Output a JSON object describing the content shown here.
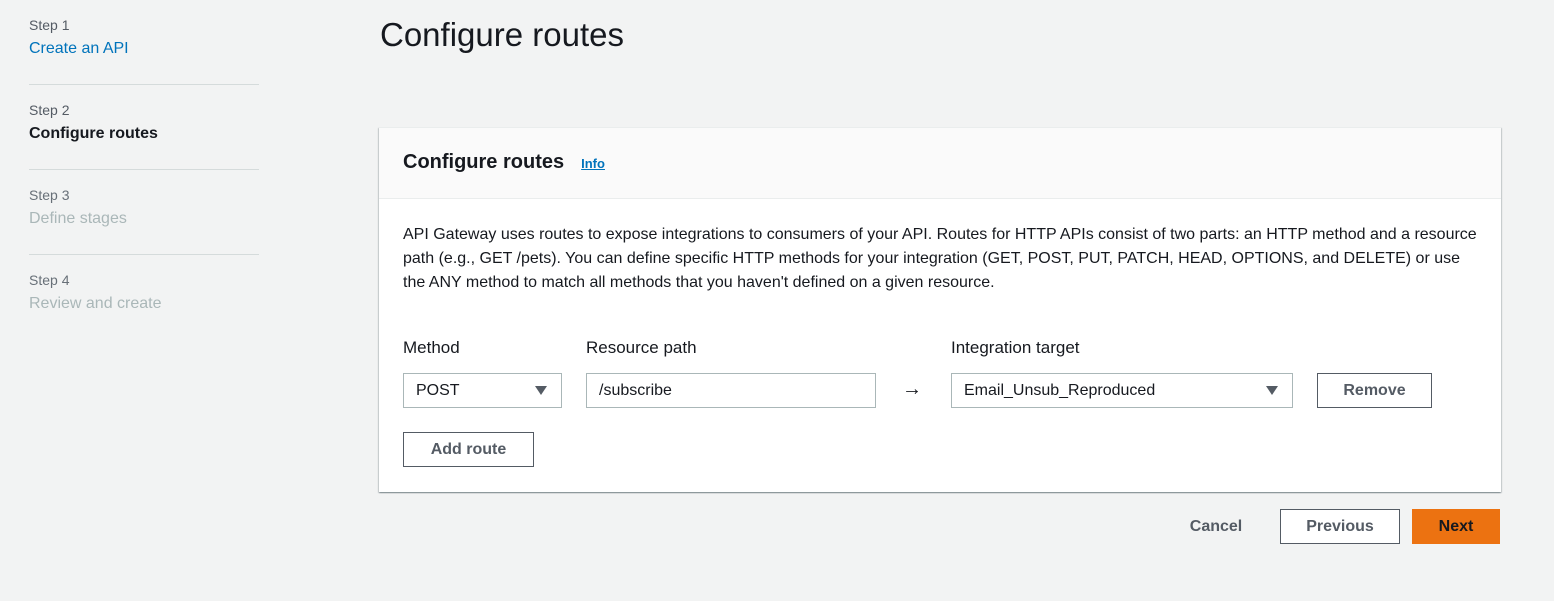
{
  "steps": [
    {
      "num": "Step 1",
      "title": "Create an API"
    },
    {
      "num": "Step 2",
      "title": "Configure routes"
    },
    {
      "num": "Step 3",
      "title": "Define stages"
    },
    {
      "num": "Step 4",
      "title": "Review and create"
    }
  ],
  "page_title": "Configure routes",
  "panel": {
    "title": "Configure routes",
    "info_label": "Info",
    "description": "API Gateway uses routes to expose integrations to consumers of your API. Routes for HTTP APIs consist of two parts: an HTTP method and a resource path (e.g., GET /pets). You can define specific HTTP methods for your integration (GET, POST, PUT, PATCH, HEAD, OPTIONS, and DELETE) or use the ANY method to match all methods that you haven't defined on a given resource."
  },
  "route": {
    "method_label": "Method",
    "path_label": "Resource path",
    "target_label": "Integration target",
    "method_value": "POST",
    "path_value": "/subscribe",
    "arrow": "→",
    "target_value": "Email_Unsub_Reproduced",
    "remove_label": "Remove",
    "add_route_label": "Add route"
  },
  "footer": {
    "cancel_label": "Cancel",
    "previous_label": "Previous",
    "next_label": "Next"
  },
  "colors": {
    "link": "#0073bb",
    "primary": "#ec7211",
    "background": "#f2f3f3"
  }
}
